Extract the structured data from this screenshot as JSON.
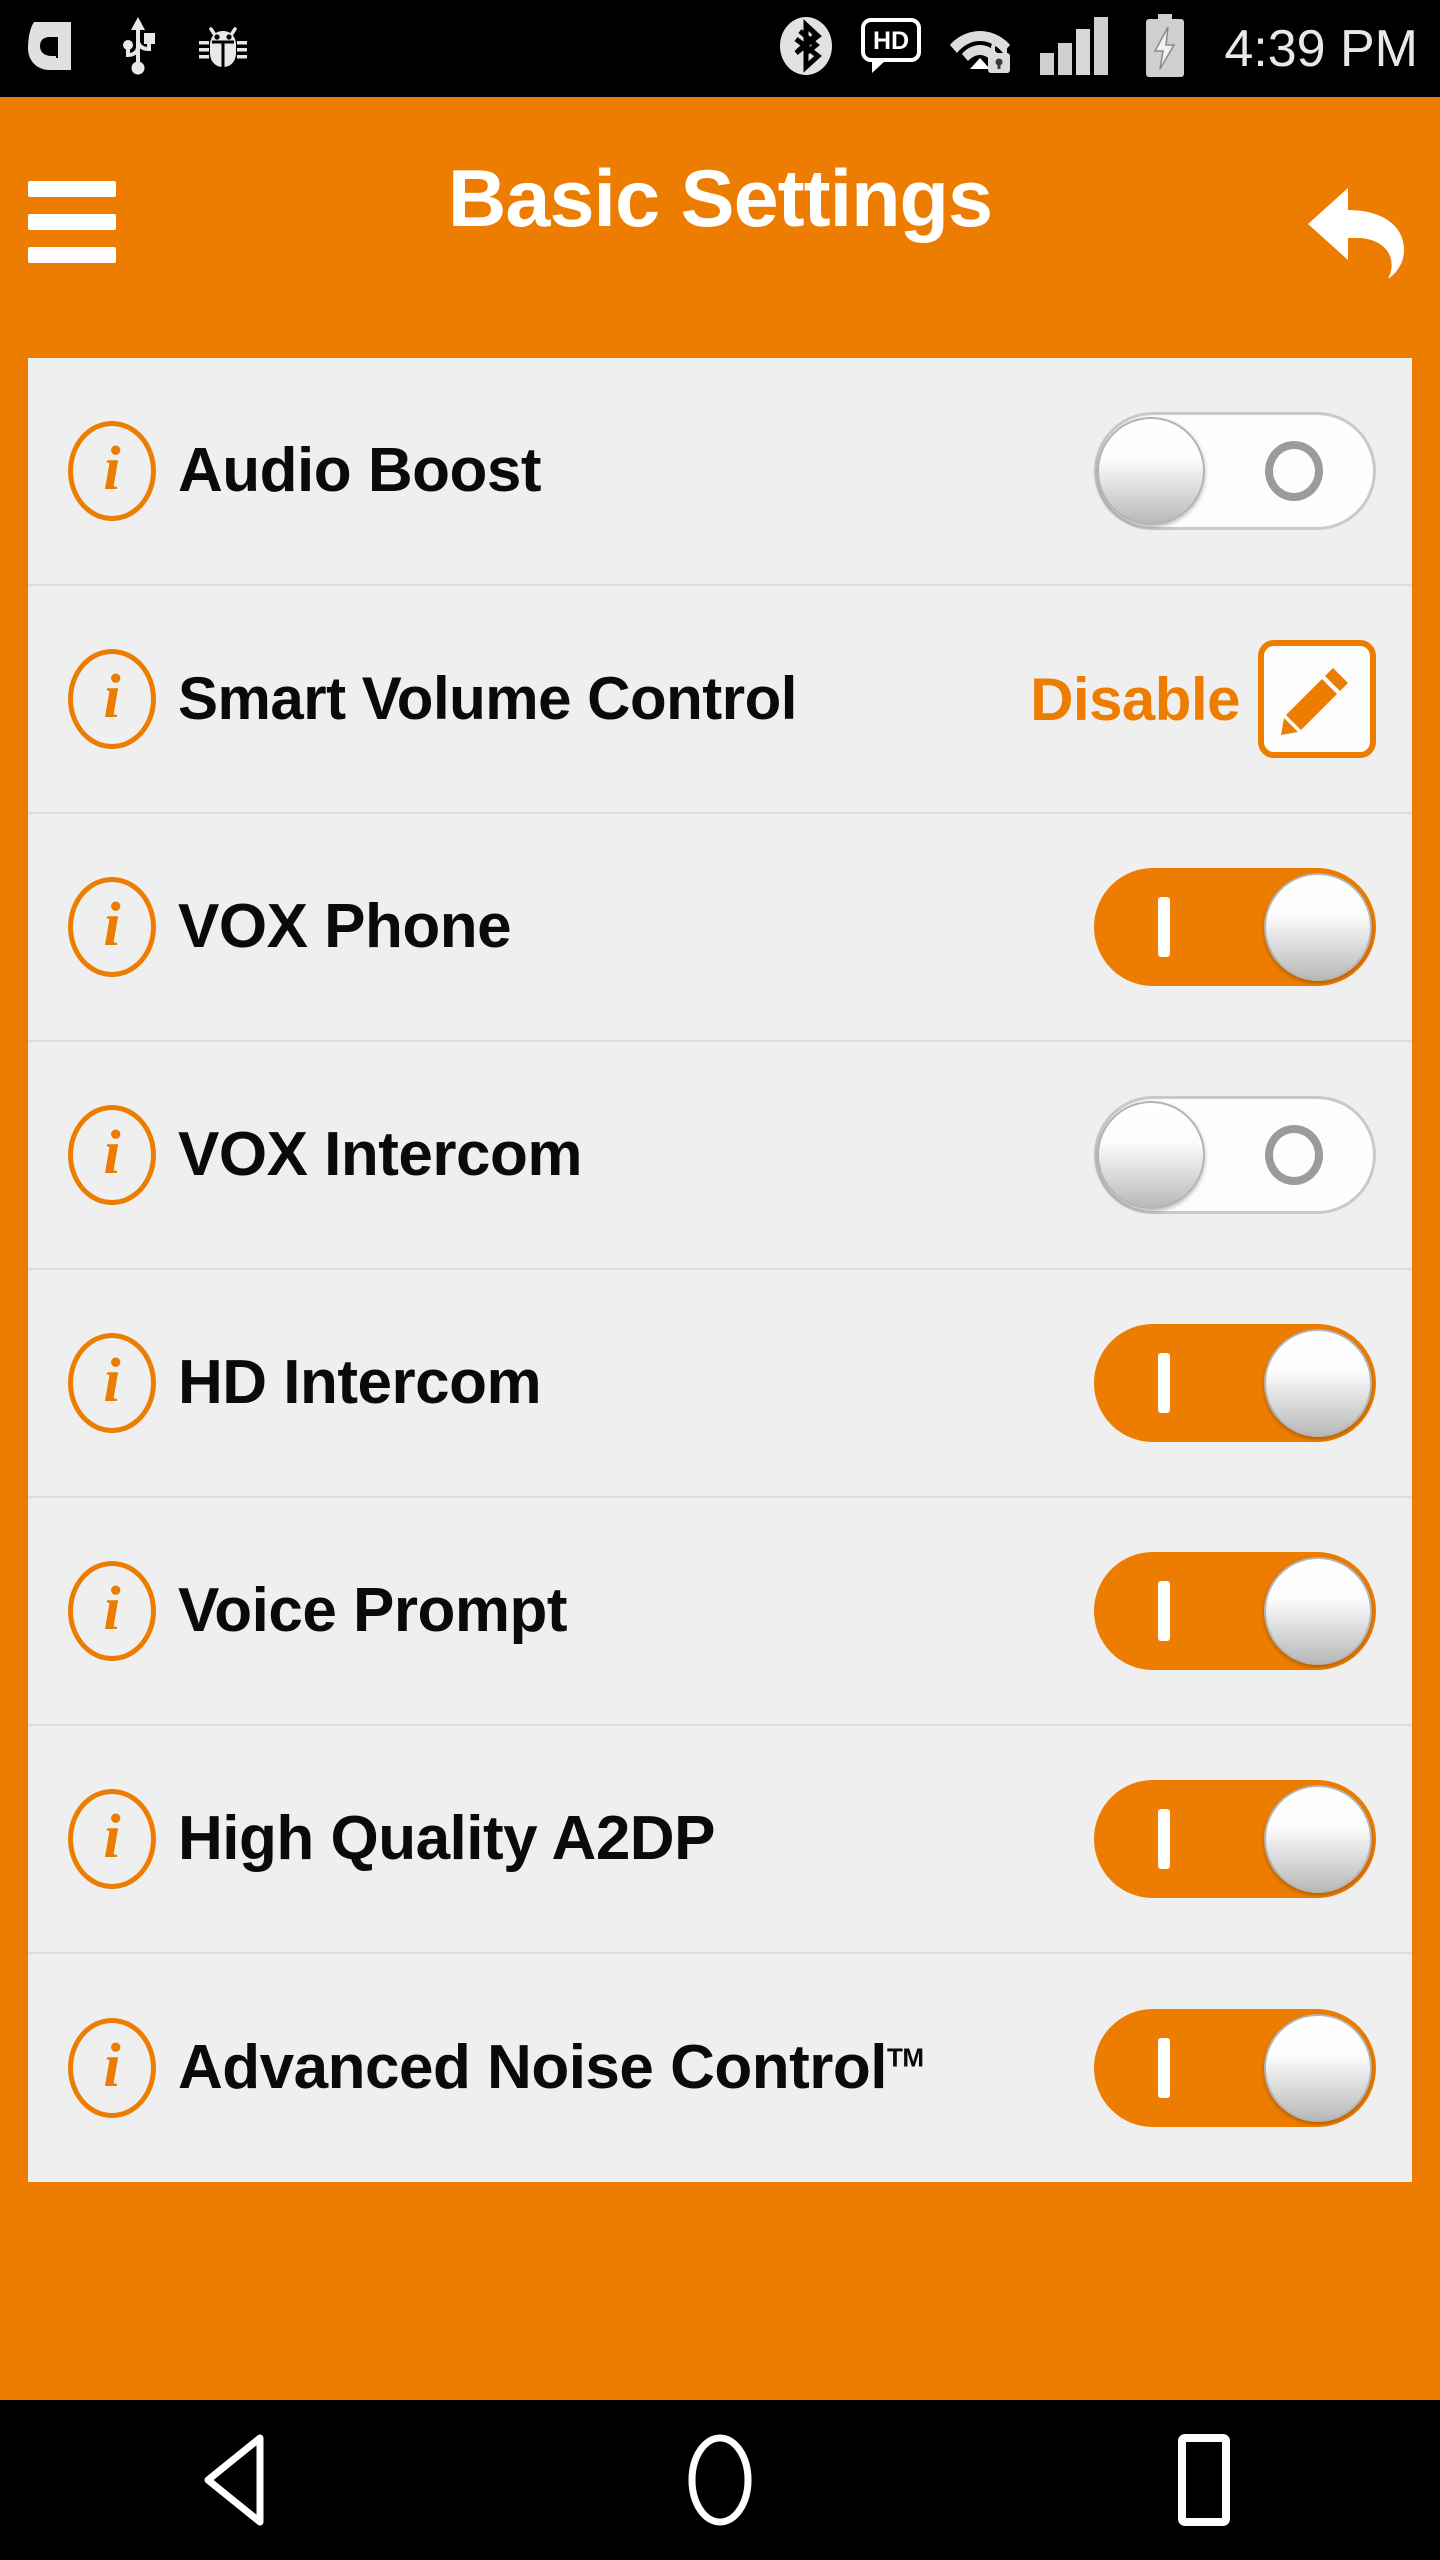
{
  "status_bar": {
    "left_icons": [
      {
        "name": "sena-app-icon",
        "label": "Sena"
      },
      {
        "name": "usb-icon",
        "label": "USB"
      },
      {
        "name": "debug-bug-icon",
        "label": "USB debugging"
      }
    ],
    "right_icons": [
      {
        "name": "bluetooth-icon",
        "label": "Bluetooth"
      },
      {
        "name": "hd-voice-icon",
        "label": "HD"
      },
      {
        "name": "wifi-secured-icon",
        "label": "Wi-Fi secured"
      },
      {
        "name": "cellular-signal-icon",
        "label": "Signal"
      },
      {
        "name": "battery-charging-icon",
        "label": "Battery charging"
      }
    ],
    "clock": "4:39 PM"
  },
  "header": {
    "title": "Basic Settings",
    "menu_icon": "hamburger-menu-icon",
    "back_icon": "back-undo-arrow-icon"
  },
  "colors": {
    "accent_orange": "#ED7D00",
    "card_background": "#EFEFEF",
    "divider": "#DCDCDC",
    "status_bar": "#000000",
    "label_text": "#0A0A0A"
  },
  "settings": {
    "rows": [
      {
        "label": "Audio Boost",
        "control": "toggle",
        "state": "off",
        "info_icon": "info-icon",
        "on_mark": "I",
        "off_mark": "O"
      },
      {
        "label": "Smart Volume Control",
        "control": "value-edit",
        "value": "Disable",
        "info_icon": "info-icon",
        "edit_icon": "pencil-edit-icon"
      },
      {
        "label": "VOX Phone",
        "control": "toggle",
        "state": "on",
        "info_icon": "info-icon",
        "on_mark": "I",
        "off_mark": "O"
      },
      {
        "label": "VOX Intercom",
        "control": "toggle",
        "state": "off",
        "info_icon": "info-icon",
        "on_mark": "I",
        "off_mark": "O"
      },
      {
        "label": "HD Intercom",
        "control": "toggle",
        "state": "on",
        "info_icon": "info-icon",
        "on_mark": "I",
        "off_mark": "O"
      },
      {
        "label": "Voice Prompt",
        "control": "toggle",
        "state": "on",
        "info_icon": "info-icon",
        "on_mark": "I",
        "off_mark": "O"
      },
      {
        "label": "High Quality A2DP",
        "control": "toggle",
        "state": "on",
        "info_icon": "info-icon",
        "on_mark": "I",
        "off_mark": "O"
      },
      {
        "label": "Advanced Noise Control",
        "label_suffix": "TM",
        "control": "toggle",
        "state": "on",
        "info_icon": "info-icon",
        "on_mark": "I",
        "off_mark": "O"
      }
    ],
    "info_glyph": "i"
  },
  "nav_bar": {
    "buttons": [
      {
        "name": "nav-back-button",
        "icon": "triangle-back-icon"
      },
      {
        "name": "nav-home-button",
        "icon": "circle-home-icon"
      },
      {
        "name": "nav-recents-button",
        "icon": "square-recents-icon"
      }
    ]
  }
}
